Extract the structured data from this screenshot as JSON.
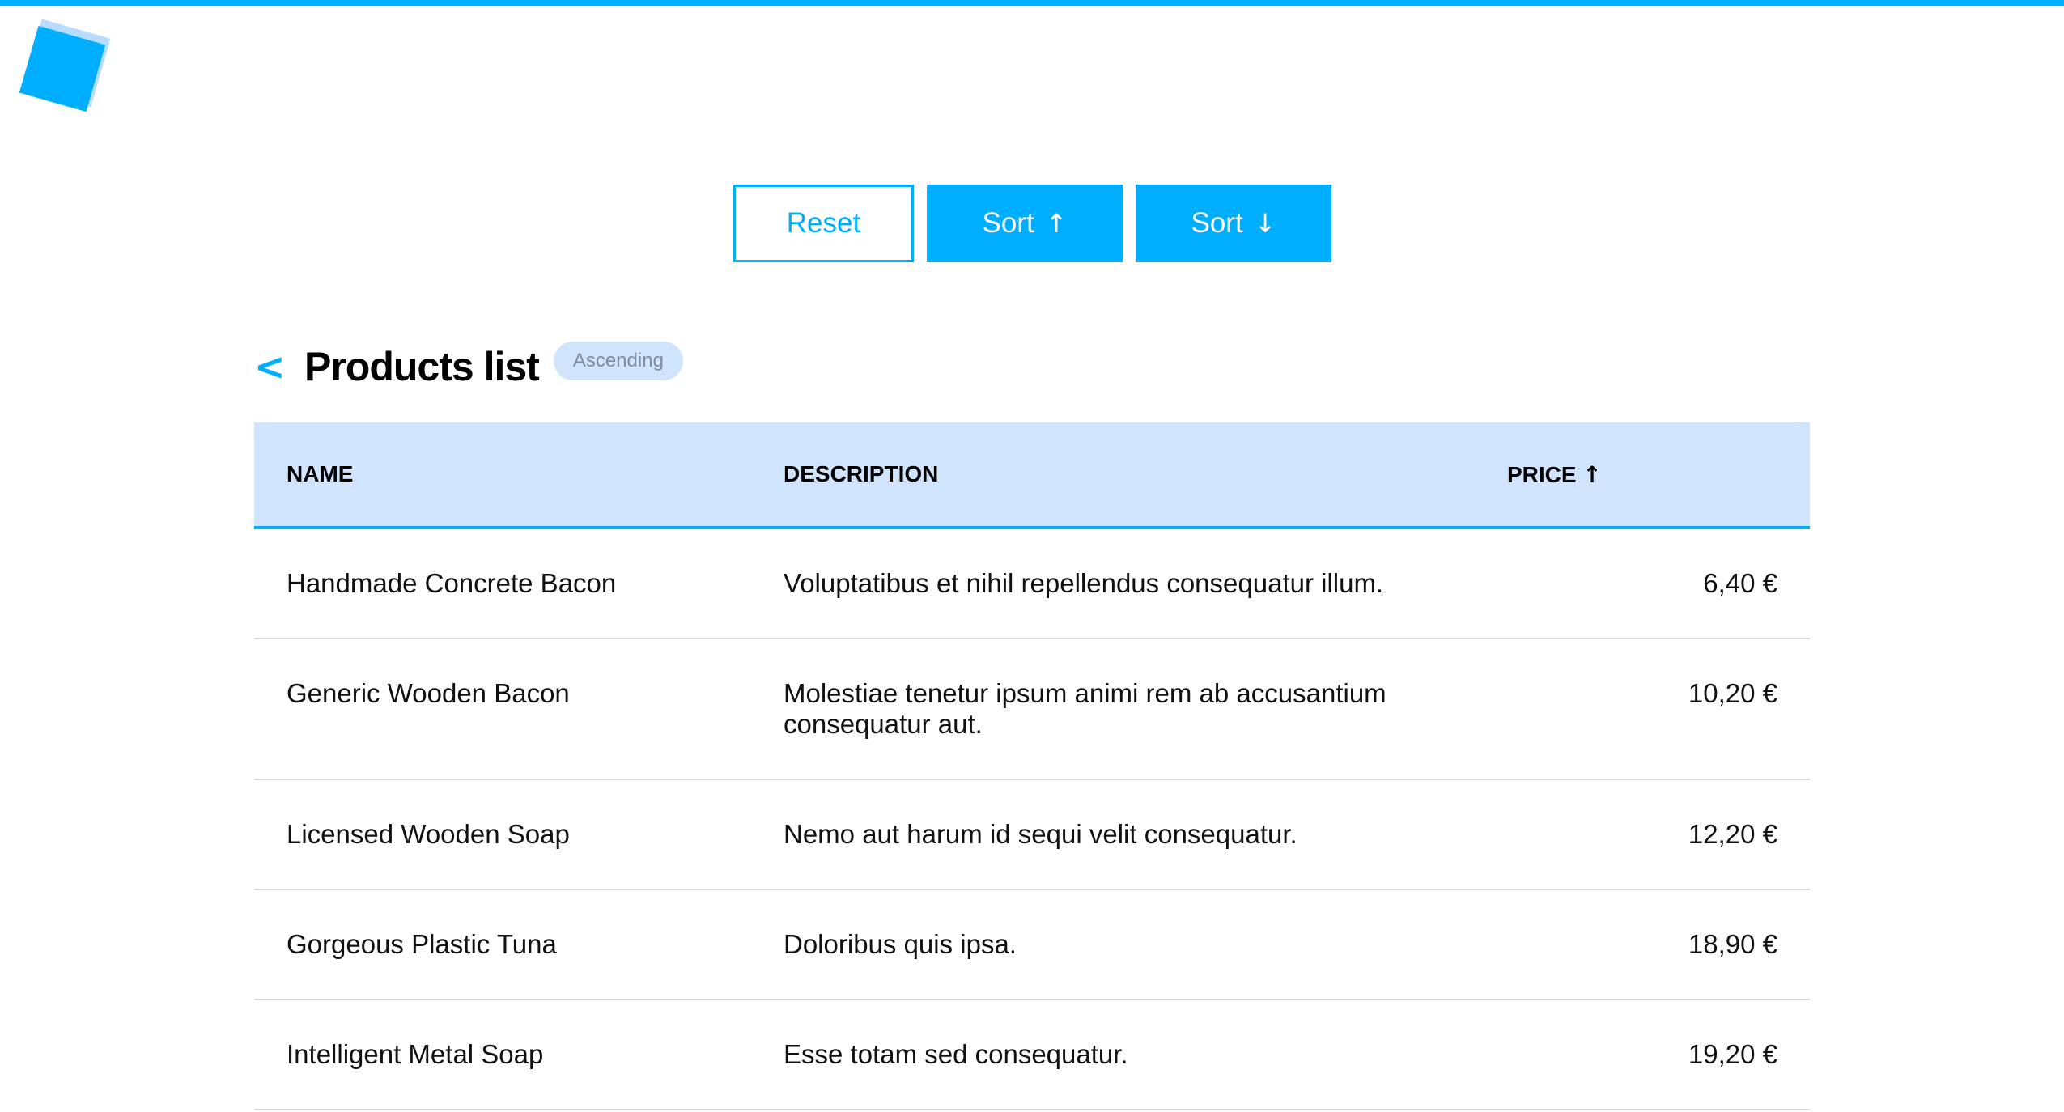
{
  "colors": {
    "accent": "#00aeff",
    "header_bg": "#d0e5fd",
    "badge_bg": "#d0e5fd"
  },
  "toolbar": {
    "reset_label": "Reset",
    "sort_asc_label": "Sort",
    "sort_asc_icon": "↑",
    "sort_desc_label": "Sort",
    "sort_desc_icon": "↓"
  },
  "heading": {
    "back_icon": "<",
    "title": "Products list",
    "badge": "Ascending"
  },
  "table": {
    "columns": {
      "name": "NAME",
      "description": "DESCRIPTION",
      "price": "PRICE",
      "price_sort_icon": "↑"
    },
    "rows": [
      {
        "name": "Handmade Concrete Bacon",
        "description": "Voluptatibus et nihil repellendus consequatur illum.",
        "price": "6,40 €"
      },
      {
        "name": "Generic Wooden Bacon",
        "description": "Molestiae tenetur ipsum animi rem ab accusantium consequatur aut.",
        "price": "10,20 €"
      },
      {
        "name": "Licensed Wooden Soap",
        "description": "Nemo aut harum id sequi velit consequatur.",
        "price": "12,20 €"
      },
      {
        "name": "Gorgeous Plastic Tuna",
        "description": "Doloribus quis ipsa.",
        "price": "18,90 €"
      },
      {
        "name": "Intelligent Metal Soap",
        "description": "Esse totam sed consequatur.",
        "price": "19,20 €"
      }
    ]
  }
}
